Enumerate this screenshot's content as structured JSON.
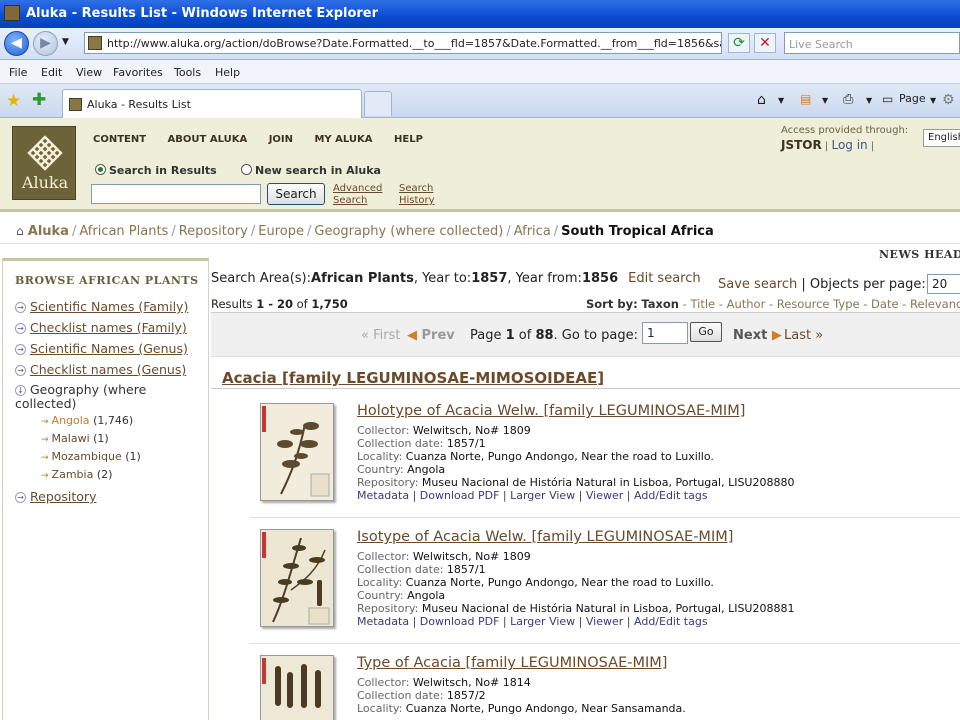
{
  "window": {
    "title": "Aluka - Results List - Windows Internet Explorer"
  },
  "browser": {
    "url": "http://www.aluka.org/action/doBrowse?Date.Formatted.__to___fld=1857&Date.Formatted.__from___fld=1856&sa=api&st",
    "live_search_placeholder": "Live Search",
    "menu": [
      "File",
      "Edit",
      "View",
      "Favorites",
      "Tools",
      "Help"
    ],
    "tab_label": "Aluka - Results List",
    "page_button": "Page"
  },
  "site": {
    "logo_text": "Aluka",
    "nav": [
      "CONTENT",
      "ABOUT ALUKA",
      "JOIN",
      "MY ALUKA",
      "HELP"
    ],
    "access_label": "Access provided through:",
    "access_org": "JSTOR",
    "login": "Log in",
    "language": "English",
    "search_in_results": "Search in Results",
    "new_search": "New search in Aluka",
    "search_button": "Search",
    "advanced_search_1": "Advanced",
    "advanced_search_2": "Search",
    "search_history_1": "Search",
    "search_history_2": "History",
    "news_headline": "NEWS HEADLINES"
  },
  "breadcrumb": [
    "Aluka",
    "African Plants",
    "Repository",
    "Europe",
    "Geography (where collected)",
    "Africa",
    "South Tropical Africa"
  ],
  "sidebar": {
    "heading": "BROWSE AFRICAN PLANTS",
    "items": [
      "Scientific Names (Family)",
      "Checklist names (Family)",
      "Scientific Names (Genus)",
      "Checklist names (Genus)"
    ],
    "geo_label": "Geography (where collected)",
    "geo_sub": [
      {
        "name": "Angola",
        "count": "(1,746)"
      },
      {
        "name": "Malawi",
        "count": "(1)"
      },
      {
        "name": "Mozambique",
        "count": "(1)"
      },
      {
        "name": "Zambia",
        "count": "(2)"
      }
    ],
    "repository": "Repository"
  },
  "results": {
    "search_area_label": "Search Area(s):",
    "search_area_value": "African Plants",
    "year_to_label": ", Year to:",
    "year_to": "1857",
    "year_from_label": ", Year from:",
    "year_from": "1856",
    "edit_search": "Edit search",
    "save_search": "Save search",
    "objects_per_page_label": "Objects per page:",
    "objects_per_page": "20",
    "results_prefix": "Results ",
    "results_range": "1 - 20",
    "results_of": " of ",
    "results_total": "1,750",
    "sort_by_label": "Sort by:",
    "sort_current": "Taxon",
    "sort_options": [
      "Title",
      "Author",
      "Resource Type",
      "Date",
      "Relevance"
    ],
    "pager": {
      "first": "« First",
      "prev": "Prev",
      "page_label": "Page ",
      "page": "1",
      "of_label": " of ",
      "total_pages": "88",
      "goto_label": ". Go to page:",
      "goto_value": "1",
      "go": "Go",
      "next": "Next",
      "last": "Last »"
    },
    "group_title": "Acacia [family LEGUMINOSAE-MIMOSOIDEAE]",
    "items": [
      {
        "title": "Holotype of Acacia Welw. [family LEGUMINOSAE-MIM]",
        "collector": "Welwitsch, No# 1809",
        "date": "1857/1",
        "locality": "Cuanza Norte, Pungo Andongo, Near the road to Luxillo.",
        "country": "Angola",
        "repository": "Museu Nacional de História Natural in Lisboa, Portugal, LISU208880"
      },
      {
        "title": "Isotype of Acacia Welw. [family LEGUMINOSAE-MIM]",
        "collector": "Welwitsch, No# 1809",
        "date": "1857/1",
        "locality": "Cuanza Norte, Pungo Andongo, Near the road to Luxillo.",
        "country": "Angola",
        "repository": "Museu Nacional de História Natural in Lisboa, Portugal, LISU208881"
      },
      {
        "title": "Type of Acacia [family LEGUMINOSAE-MIM]",
        "collector": "Welwitsch, No# 1814",
        "date": "1857/2",
        "locality": "Cuanza Norte, Pungo Andongo, Near Sansamanda.",
        "country": "",
        "repository": ""
      }
    ],
    "field_labels": {
      "collector": "Collector:",
      "date": "Collection date:",
      "locality": "Locality:",
      "country": "Country:",
      "repository": "Repository:"
    },
    "actions": [
      "Metadata",
      "Download PDF",
      "Larger View",
      "Viewer",
      "Add/Edit tags"
    ]
  }
}
